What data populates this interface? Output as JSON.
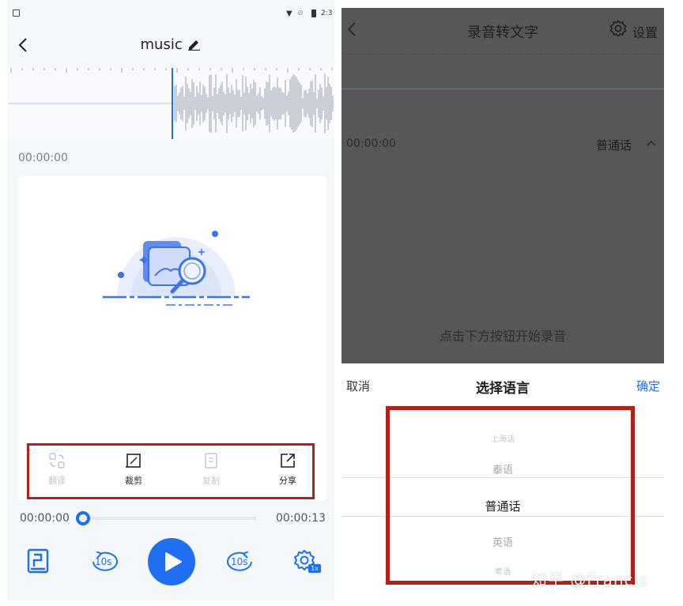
{
  "left": {
    "status_time": "2:3",
    "title": "music",
    "current_time": "00:00:00",
    "tools": [
      {
        "label": "翻译",
        "icon": "translate-icon",
        "enabled": false
      },
      {
        "label": "裁剪",
        "icon": "crop-icon",
        "enabled": true
      },
      {
        "label": "复制",
        "icon": "copy-icon",
        "enabled": false
      },
      {
        "label": "分享",
        "icon": "share-icon",
        "enabled": true
      }
    ],
    "progress": {
      "start": "00:00:00",
      "end": "00:00:13",
      "fraction": 0.0
    },
    "controls": {
      "rewind_label": "10s",
      "forward_label": "10s",
      "speed_badge": "1x"
    },
    "colors": {
      "accent": "#1e6ff1",
      "highlight_box": "#b3201c"
    }
  },
  "right": {
    "title": "录音转文字",
    "settings_label": "设置",
    "time": "00:00:00",
    "language": "普通话",
    "hint": "点击下方按钮开始录音",
    "sheet": {
      "cancel": "取消",
      "title": "选择语言",
      "confirm": "确定",
      "options": [
        "上海话",
        "泰语",
        "普通话",
        "英语",
        "粤语"
      ],
      "selected": "普通话"
    }
  },
  "watermark": "知乎 @Francis"
}
